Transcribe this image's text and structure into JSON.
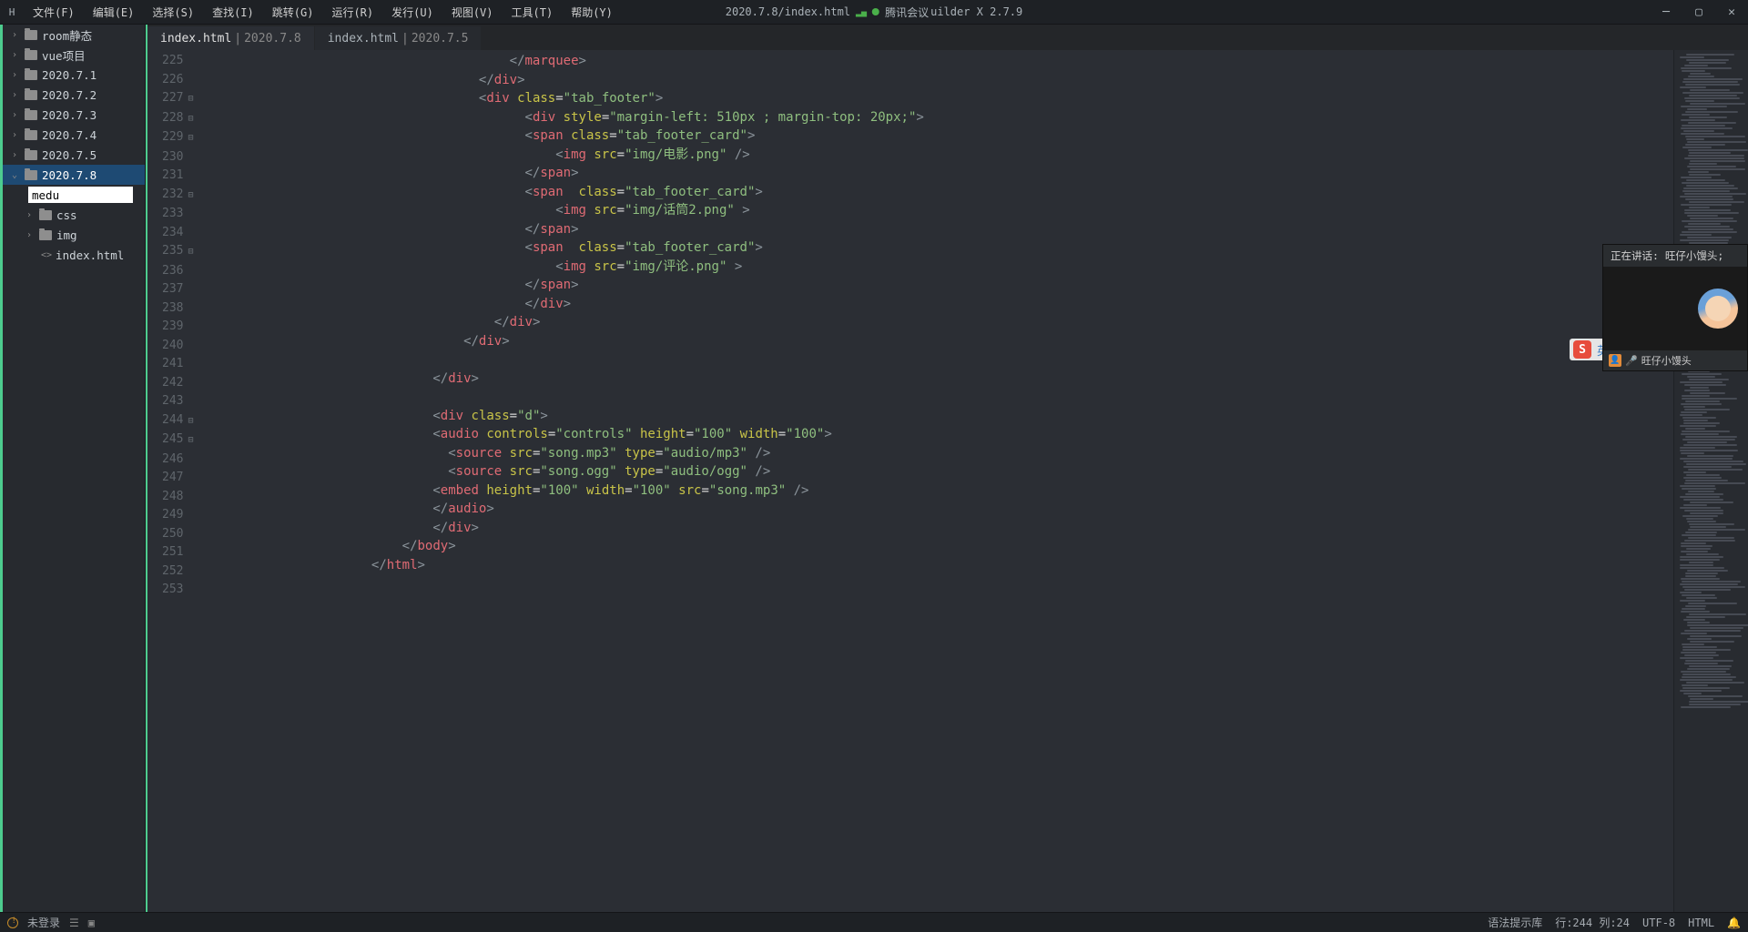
{
  "menu": [
    "文件(F)",
    "编辑(E)",
    "选择(S)",
    "查找(I)",
    "跳转(G)",
    "运行(R)",
    "发行(U)",
    "视图(V)",
    "工具(T)",
    "帮助(Y)"
  ],
  "title": {
    "path": "2020.7.8/index.html",
    "extra": "腾讯会议",
    "app": "uilder X 2.7.9"
  },
  "tree": {
    "items": [
      "room静态",
      "vue项目",
      "2020.7.1",
      "2020.7.2",
      "2020.7.3",
      "2020.7.4",
      "2020.7.5",
      "2020.7.8"
    ],
    "rename_value": "medu",
    "children": [
      "css",
      "img",
      "index.html"
    ]
  },
  "tabs": [
    {
      "file": "index.html",
      "path": "2020.7.8",
      "active": true
    },
    {
      "file": "index.html",
      "path": "2020.7.5",
      "active": false
    }
  ],
  "lines": {
    "start": 225,
    "rows": [
      {
        "n": 225,
        "indent": 40,
        "t": [
          [
            "br",
            "</"
          ],
          [
            "tag",
            "marquee"
          ],
          [
            "br",
            ">"
          ]
        ]
      },
      {
        "n": 226,
        "fold": false,
        "indent": 36,
        "t": [
          [
            "br",
            "</"
          ],
          [
            "tag",
            "div"
          ],
          [
            "br",
            ">"
          ]
        ]
      },
      {
        "n": 227,
        "fold": true,
        "indent": 36,
        "t": [
          [
            "br",
            "<"
          ],
          [
            "tag",
            "div"
          ],
          [
            "",
            ""
          ],
          [
            "attr",
            " class"
          ],
          [
            "eq",
            "="
          ],
          [
            "str",
            "\"tab_footer\""
          ],
          [
            "br",
            ">"
          ]
        ]
      },
      {
        "n": 228,
        "fold": true,
        "indent": 42,
        "t": [
          [
            "br",
            "<"
          ],
          [
            "tag",
            "div"
          ],
          [
            "attr",
            " style"
          ],
          [
            "eq",
            "="
          ],
          [
            "str",
            "\"margin-left: 510px ; margin-top: 20px;\""
          ],
          [
            "br",
            ">"
          ]
        ]
      },
      {
        "n": 229,
        "fold": true,
        "indent": 42,
        "t": [
          [
            "br",
            "<"
          ],
          [
            "tag",
            "span"
          ],
          [
            "attr",
            " class"
          ],
          [
            "eq",
            "="
          ],
          [
            "str",
            "\"tab_footer_card\""
          ],
          [
            "br",
            ">"
          ]
        ]
      },
      {
        "n": 230,
        "fold": false,
        "indent": 46,
        "t": [
          [
            "br",
            "<"
          ],
          [
            "tag",
            "img"
          ],
          [
            "attr",
            " src"
          ],
          [
            "eq",
            "="
          ],
          [
            "str",
            "\"img/电影.png\""
          ],
          [
            "br",
            " />"
          ]
        ]
      },
      {
        "n": 231,
        "fold": false,
        "indent": 42,
        "t": [
          [
            "br",
            "</"
          ],
          [
            "tag",
            "span"
          ],
          [
            "br",
            ">"
          ]
        ]
      },
      {
        "n": 232,
        "fold": true,
        "indent": 42,
        "t": [
          [
            "br",
            "<"
          ],
          [
            "tag",
            "span"
          ],
          [
            "attr",
            "  class"
          ],
          [
            "eq",
            "="
          ],
          [
            "str",
            "\"tab_footer_card\""
          ],
          [
            "br",
            ">"
          ]
        ]
      },
      {
        "n": 233,
        "fold": false,
        "indent": 46,
        "t": [
          [
            "br",
            "<"
          ],
          [
            "tag",
            "img"
          ],
          [
            "attr",
            " src"
          ],
          [
            "eq",
            "="
          ],
          [
            "str",
            "\"img/话筒2.png\""
          ],
          [
            "br",
            " >"
          ]
        ]
      },
      {
        "n": 234,
        "fold": false,
        "indent": 42,
        "t": [
          [
            "br",
            "</"
          ],
          [
            "tag",
            "span"
          ],
          [
            "br",
            ">"
          ]
        ]
      },
      {
        "n": 235,
        "fold": true,
        "indent": 42,
        "t": [
          [
            "br",
            "<"
          ],
          [
            "tag",
            "span"
          ],
          [
            "attr",
            "  class"
          ],
          [
            "eq",
            "="
          ],
          [
            "str",
            "\"tab_footer_card\""
          ],
          [
            "br",
            ">"
          ]
        ]
      },
      {
        "n": 236,
        "fold": false,
        "indent": 46,
        "t": [
          [
            "br",
            "<"
          ],
          [
            "tag",
            "img"
          ],
          [
            "attr",
            " src"
          ],
          [
            "eq",
            "="
          ],
          [
            "str",
            "\"img/评论.png\""
          ],
          [
            "br",
            " >"
          ]
        ]
      },
      {
        "n": 237,
        "fold": false,
        "indent": 42,
        "t": [
          [
            "br",
            "</"
          ],
          [
            "tag",
            "span"
          ],
          [
            "br",
            ">"
          ]
        ]
      },
      {
        "n": 238,
        "fold": false,
        "indent": 42,
        "t": [
          [
            "br",
            "</"
          ],
          [
            "tag",
            "div"
          ],
          [
            "br",
            ">"
          ]
        ]
      },
      {
        "n": 239,
        "fold": false,
        "indent": 38,
        "t": [
          [
            "br",
            "</"
          ],
          [
            "tag",
            "div"
          ],
          [
            "br",
            ">"
          ]
        ]
      },
      {
        "n": 240,
        "fold": false,
        "indent": 34,
        "t": [
          [
            "br",
            "</"
          ],
          [
            "tag",
            "div"
          ],
          [
            "br",
            ">"
          ]
        ]
      },
      {
        "n": 241,
        "indent": 0,
        "t": []
      },
      {
        "n": 242,
        "fold": false,
        "indent": 30,
        "t": [
          [
            "br",
            "</"
          ],
          [
            "tag",
            "div"
          ],
          [
            "br",
            ">"
          ]
        ]
      },
      {
        "n": 243,
        "indent": 0,
        "t": []
      },
      {
        "n": 244,
        "fold": true,
        "indent": 30,
        "t": [
          [
            "br",
            "<"
          ],
          [
            "tag",
            "div"
          ],
          [
            "attr",
            " class"
          ],
          [
            "eq",
            "="
          ],
          [
            "str",
            "\"d\""
          ],
          [
            "br",
            ">"
          ]
        ]
      },
      {
        "n": 245,
        "fold": true,
        "indent": 30,
        "t": [
          [
            "br",
            "<"
          ],
          [
            "tag",
            "audio"
          ],
          [
            "attr",
            " controls"
          ],
          [
            "eq",
            "="
          ],
          [
            "str",
            "\"controls\""
          ],
          [
            "attr",
            " height"
          ],
          [
            "eq",
            "="
          ],
          [
            "str",
            "\"100\""
          ],
          [
            "attr",
            " width"
          ],
          [
            "eq",
            "="
          ],
          [
            "str",
            "\"100\""
          ],
          [
            "br",
            ">"
          ]
        ]
      },
      {
        "n": 246,
        "fold": false,
        "indent": 32,
        "t": [
          [
            "br",
            "<"
          ],
          [
            "tag",
            "source"
          ],
          [
            "attr",
            " src"
          ],
          [
            "eq",
            "="
          ],
          [
            "str",
            "\"song.mp3\""
          ],
          [
            "attr",
            " type"
          ],
          [
            "eq",
            "="
          ],
          [
            "str",
            "\"audio/mp3\""
          ],
          [
            "br",
            " />"
          ]
        ]
      },
      {
        "n": 247,
        "fold": false,
        "indent": 32,
        "t": [
          [
            "br",
            "<"
          ],
          [
            "tag",
            "source"
          ],
          [
            "attr",
            " src"
          ],
          [
            "eq",
            "="
          ],
          [
            "str",
            "\"song.ogg\""
          ],
          [
            "attr",
            " type"
          ],
          [
            "eq",
            "="
          ],
          [
            "str",
            "\"audio/ogg\""
          ],
          [
            "br",
            " />"
          ]
        ]
      },
      {
        "n": 248,
        "fold": false,
        "indent": 30,
        "t": [
          [
            "br",
            "<"
          ],
          [
            "tag",
            "embed"
          ],
          [
            "attr",
            " height"
          ],
          [
            "eq",
            "="
          ],
          [
            "str",
            "\"100\""
          ],
          [
            "attr",
            " width"
          ],
          [
            "eq",
            "="
          ],
          [
            "str",
            "\"100\""
          ],
          [
            "attr",
            " src"
          ],
          [
            "eq",
            "="
          ],
          [
            "str",
            "\"song.mp3\""
          ],
          [
            "br",
            " />"
          ]
        ]
      },
      {
        "n": 249,
        "fold": false,
        "indent": 30,
        "t": [
          [
            "br",
            "</"
          ],
          [
            "tag",
            "audio"
          ],
          [
            "br",
            ">"
          ]
        ]
      },
      {
        "n": 250,
        "fold": false,
        "indent": 30,
        "t": [
          [
            "br",
            "</"
          ],
          [
            "tag",
            "div"
          ],
          [
            "br",
            ">"
          ]
        ]
      },
      {
        "n": 251,
        "fold": false,
        "indent": 26,
        "t": [
          [
            "br",
            "</"
          ],
          [
            "tag",
            "body"
          ],
          [
            "br",
            ">"
          ]
        ]
      },
      {
        "n": 252,
        "fold": false,
        "indent": 22,
        "t": [
          [
            "br",
            "</"
          ],
          [
            "tag",
            "html"
          ],
          [
            "br",
            ">"
          ]
        ]
      },
      {
        "n": 253,
        "indent": 0,
        "t": []
      }
    ]
  },
  "status": {
    "login": "未登录",
    "syntax": "语法提示库",
    "pos": "行:244 列:24",
    "encoding": "UTF-8",
    "lang": "HTML"
  },
  "meeting": {
    "speaking": "正在讲话: 旺仔小馒头;",
    "user": "旺仔小馒头"
  },
  "ime": {
    "lang": "英"
  }
}
